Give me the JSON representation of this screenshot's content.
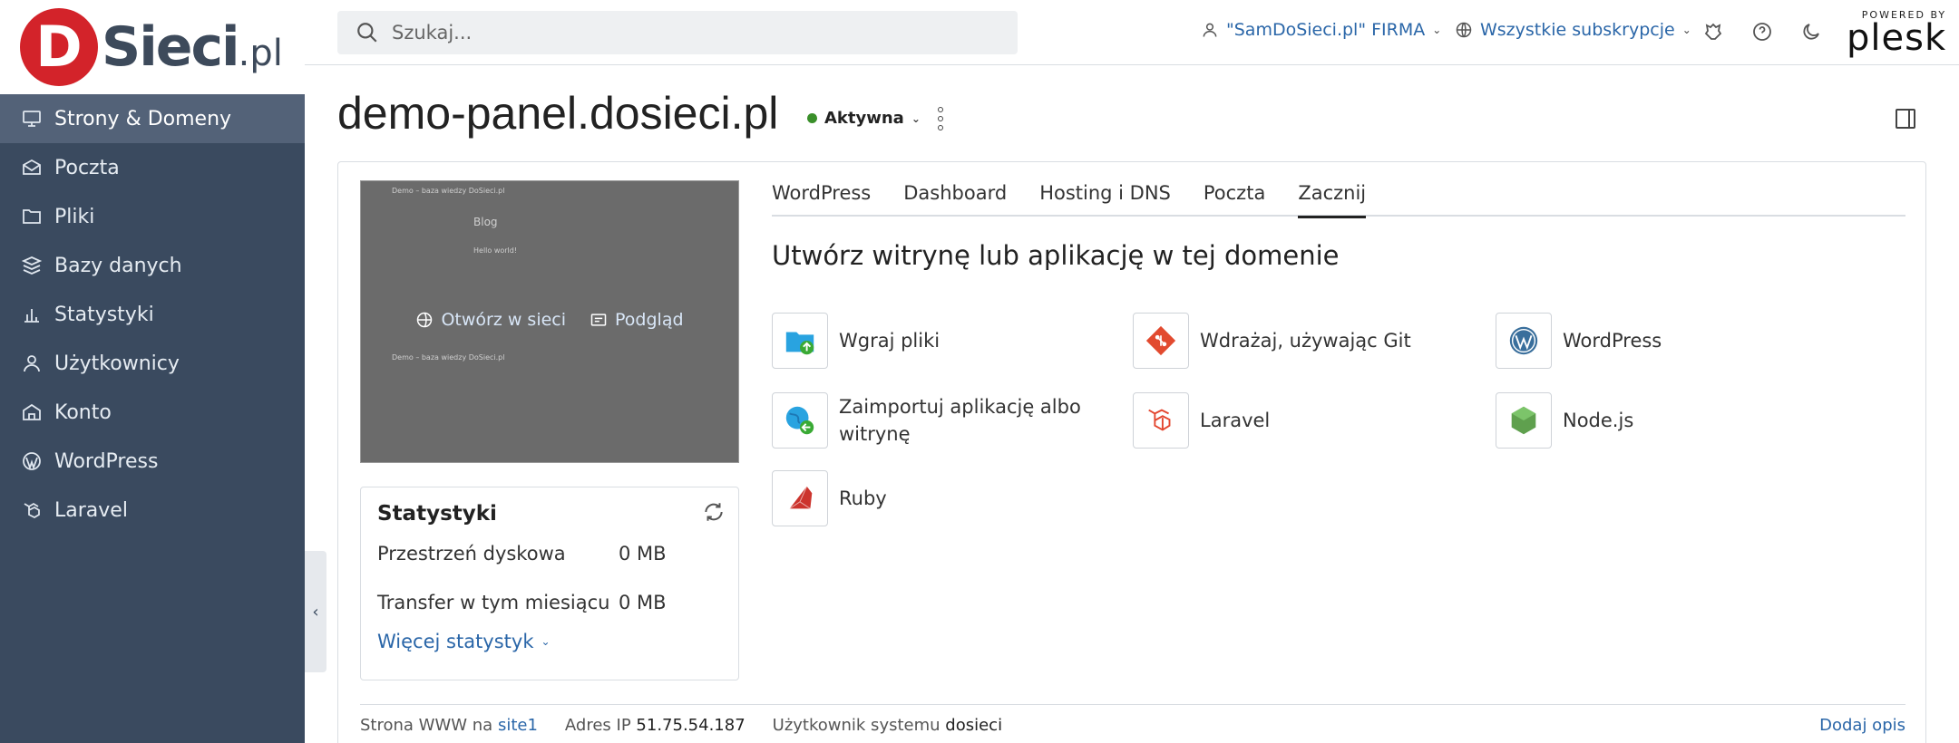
{
  "brand": {
    "logo_letter": "D",
    "logo_text": "Sieci",
    "logo_suffix": ".pl"
  },
  "sidebar": {
    "items": [
      {
        "label": "Strony & Domeny",
        "icon": "monitor-icon"
      },
      {
        "label": "Poczta",
        "icon": "mail-icon"
      },
      {
        "label": "Pliki",
        "icon": "folder-icon"
      },
      {
        "label": "Bazy danych",
        "icon": "database-icon"
      },
      {
        "label": "Statystyki",
        "icon": "bar-chart-icon"
      },
      {
        "label": "Użytkownicy",
        "icon": "user-icon"
      },
      {
        "label": "Konto",
        "icon": "account-icon"
      },
      {
        "label": "WordPress",
        "icon": "wordpress-icon"
      },
      {
        "label": "Laravel",
        "icon": "laravel-icon"
      }
    ]
  },
  "topbar": {
    "search_placeholder": "Szukaj...",
    "account": "\"SamDoSieci.pl\" FIRMA",
    "subscriptions": "Wszystkie subskrypcje",
    "powered_by": "POWERED BY",
    "plesk": "plesk"
  },
  "header": {
    "title": "demo-panel.dosieci.pl",
    "status": "Aktywna"
  },
  "preview": {
    "open_label": "Otwórz w sieci",
    "preview_label": "Podgląd",
    "mini_site": "Demo – baza wiedzy DoSieci.pl",
    "mini_blog": "Blog",
    "mini_hello": "Hello world!"
  },
  "stats": {
    "title": "Statystyki",
    "disk_label": "Przestrzeń dyskowa",
    "disk_value": "0 MB",
    "transfer_label": "Transfer w tym miesiącu",
    "transfer_value": "0 MB",
    "more_label": "Więcej statystyk"
  },
  "tabs": [
    "WordPress",
    "Dashboard",
    "Hosting i DNS",
    "Poczta",
    "Zacznij"
  ],
  "section_title": "Utwórz witrynę lub aplikację w tej domenie",
  "tiles": {
    "upload": "Wgraj pliki",
    "git": "Wdrażaj, używając Git",
    "wordpress": "WordPress",
    "import": "Zaimportuj aplikację albo witrynę",
    "laravel": "Laravel",
    "nodejs": "Node.js",
    "ruby": "Ruby"
  },
  "footer": {
    "www_label": "Strona WWW na",
    "www_value": "site1",
    "ip_label": "Adres IP",
    "ip_value": "51.75.54.187",
    "user_label": "Użytkownik systemu",
    "user_value": "dosieci",
    "add_desc": "Dodaj opis"
  },
  "colors": {
    "sidebar_bg": "#3a4a5f",
    "active_item": "#536278",
    "link": "#2a66a8",
    "brand_red": "#d3232a",
    "status_green": "#3a8f2a"
  }
}
